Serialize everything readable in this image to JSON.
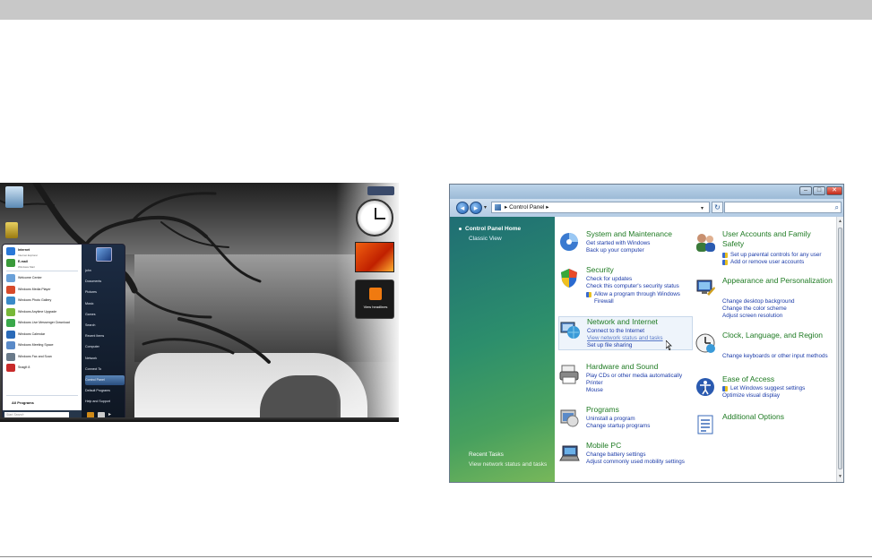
{
  "desktop": {
    "start_menu": {
      "pinned": [
        {
          "label": "Internet",
          "sub": "Internet Explorer",
          "color": "#2a78d8"
        },
        {
          "label": "E-mail",
          "sub": "Windows Mail",
          "color": "#3a9a3a"
        }
      ],
      "recent": [
        {
          "label": "Welcome Center",
          "color": "#6aa0d8"
        },
        {
          "label": "Windows Media Player",
          "color": "#d84a2a"
        },
        {
          "label": "Windows Photo Gallery",
          "color": "#3a8ac8"
        },
        {
          "label": "Windows Anytime Upgrade",
          "color": "#78b838"
        },
        {
          "label": "Windows Live Messenger Download",
          "color": "#3aa84a"
        },
        {
          "label": "Windows Calendar",
          "color": "#2a6ab8"
        },
        {
          "label": "Windows Meeting Space",
          "color": "#5a8ac8"
        },
        {
          "label": "Windows Fax and Scan",
          "color": "#6a7a8a"
        },
        {
          "label": "SnagIt 8",
          "color": "#c82a2a"
        }
      ],
      "all_programs": "All Programs",
      "search_placeholder": "Start Search",
      "right_items": [
        {
          "label": "john",
          "selected": false
        },
        {
          "label": "Documents",
          "selected": false
        },
        {
          "label": "Pictures",
          "selected": false
        },
        {
          "label": "Music",
          "selected": false
        },
        {
          "label": "Games",
          "selected": false
        },
        {
          "label": "Search",
          "selected": false
        },
        {
          "label": "Recent Items",
          "selected": false
        },
        {
          "label": "Computer",
          "selected": false
        },
        {
          "label": "Network",
          "selected": false
        },
        {
          "label": "Connect To",
          "selected": false
        },
        {
          "label": "Control Panel",
          "selected": true
        },
        {
          "label": "Default Programs",
          "selected": false
        },
        {
          "label": "Help and Support",
          "selected": false
        }
      ]
    },
    "feed_gadget_label": "View headlines"
  },
  "control_panel": {
    "address": {
      "crumb": "Control Panel",
      "separator": "▸"
    },
    "search_placeholder": "",
    "nav": {
      "home": "Control Panel Home",
      "classic": "Classic View",
      "recent_title": "Recent Tasks",
      "recent_item": "View network status and tasks"
    },
    "categories_left": [
      {
        "title": "System and Maintenance",
        "links": [
          "Get started with Windows",
          "Back up your computer"
        ],
        "icon": "system-maintenance-icon"
      },
      {
        "title": "Security",
        "links": [
          "Check for updates",
          "Check this computer's security status",
          "Allow a program through Windows Firewall"
        ],
        "icon": "security-shield-icon"
      },
      {
        "title": "Network and Internet",
        "links": [
          "Connect to the Internet",
          "View network status and tasks",
          "Set up file sharing"
        ],
        "icon": "network-globe-icon"
      },
      {
        "title": "Hardware and Sound",
        "links": [
          "Play CDs or other media automatically",
          "Printer",
          "Mouse"
        ],
        "icon": "hardware-printer-icon"
      },
      {
        "title": "Programs",
        "links": [
          "Uninstall a program",
          "Change startup programs"
        ],
        "icon": "programs-icon"
      },
      {
        "title": "Mobile PC",
        "links": [
          "Change battery settings",
          "Adjust commonly used mobility settings"
        ],
        "icon": "mobile-pc-icon"
      }
    ],
    "categories_right": [
      {
        "title": "User Accounts and Family Safety",
        "links": [
          "Set up parental controls for any user",
          "Add or remove user accounts"
        ],
        "icon": "user-accounts-icon"
      },
      {
        "title": "Appearance and Personalization",
        "links": [
          "Change desktop background",
          "Change the color scheme",
          "Adjust screen resolution"
        ],
        "icon": "appearance-icon"
      },
      {
        "title": "Clock, Language, and Region",
        "links": [
          "Change keyboards or other input methods"
        ],
        "icon": "clock-globe-icon"
      },
      {
        "title": "Ease of Access",
        "links": [
          "Let Windows suggest settings",
          "Optimize visual display"
        ],
        "icon": "ease-of-access-icon"
      },
      {
        "title": "Additional Options",
        "links": [],
        "icon": "additional-options-icon"
      }
    ],
    "colors": {
      "category_title": "#1e7a22",
      "link": "#1a3aa8"
    }
  }
}
